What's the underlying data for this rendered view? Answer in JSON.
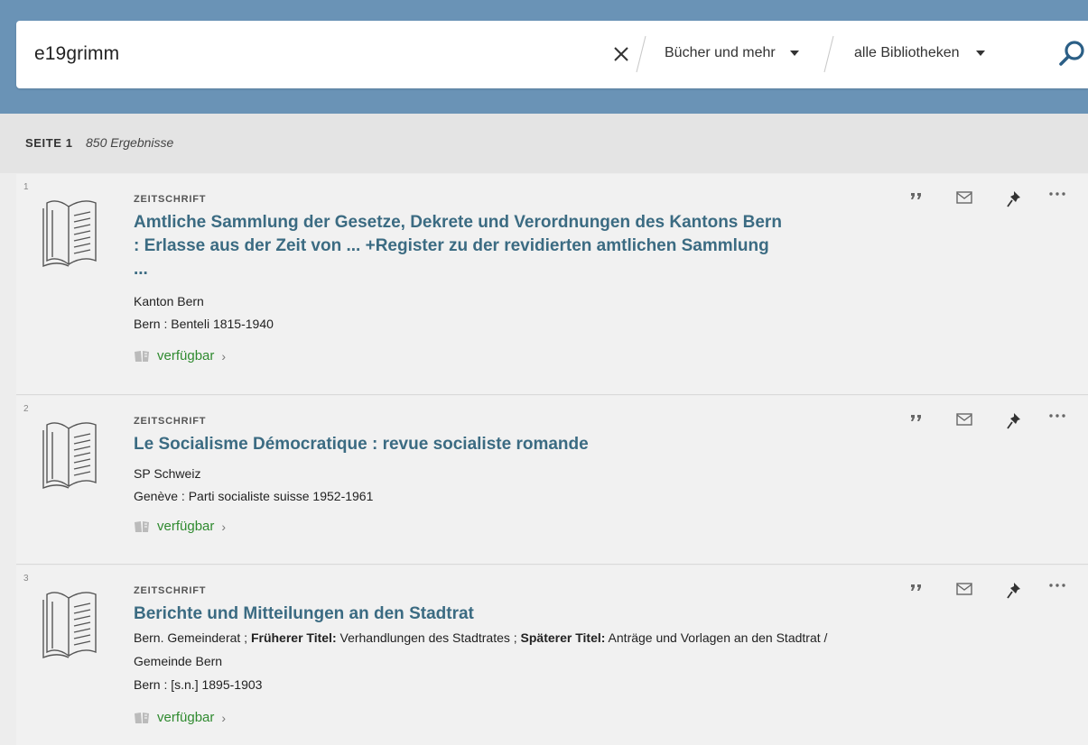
{
  "search": {
    "query": "e19grimm",
    "scope_label": "Bücher und mehr",
    "library_label": "alle Bibliotheken"
  },
  "page_info": {
    "page_label": "SEITE 1",
    "results_count": "850 Ergebnisse"
  },
  "results": [
    {
      "number": "1",
      "type": "ZEITSCHRIFT",
      "title": "Amtliche Sammlung der Gesetze, Dekrete und Verordnungen des Kantons Bern : Erlasse aus der Zeit von ... +Register zu der revidierten amtlichen Sammlung ...",
      "author": "Kanton Bern",
      "publication": "Bern : Benteli 1815-1940",
      "availability": "verfügbar"
    },
    {
      "number": "2",
      "type": "ZEITSCHRIFT",
      "title": "Le Socialisme Démocratique : revue socialiste romande",
      "author": "SP Schweiz",
      "publication": "Genève : Parti socialiste suisse 1952-1961",
      "availability": "verfügbar"
    },
    {
      "number": "3",
      "type": "ZEITSCHRIFT",
      "title": "Berichte und Mitteilungen an den Stadtrat",
      "author_prefix": "Bern. Gemeinderat ; ",
      "earlier_label": "Früherer Titel:",
      "earlier_value": " Verhandlungen des Stadtrates ; ",
      "later_label": "Späterer Titel:",
      "later_value": " Anträge und Vorlagen an den Stadtrat /",
      "author_cont": "Gemeinde Bern",
      "publication": "Bern : [s.n.] 1895-1903",
      "availability": "verfügbar"
    }
  ],
  "colors": {
    "header_blue": "#6a93b6",
    "title_link": "#3b6b82",
    "available_green": "#2f8a2f",
    "search_icon": "#2b5f86"
  },
  "icons": {
    "clear": "close-icon",
    "search": "search-icon",
    "dropdown": "caret-down-icon",
    "citation": "quote-icon",
    "email": "envelope-icon",
    "pin": "pushpin-icon",
    "more": "ellipsis-icon",
    "availability": "open-book-icon",
    "item": "book-icon"
  }
}
